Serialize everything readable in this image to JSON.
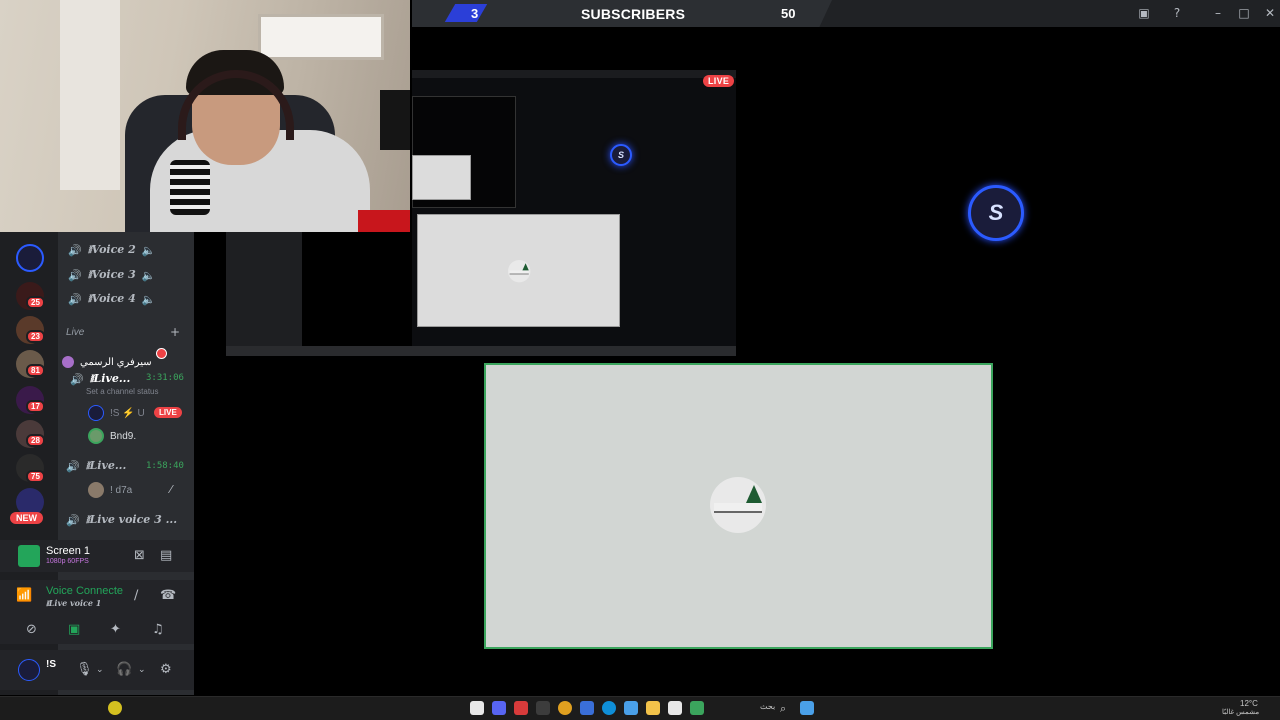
{
  "topbar": {
    "left_count": "3",
    "title": "SUBSCRIBERS",
    "right_count": "50"
  },
  "preview": {
    "live_label": "LIVE",
    "logo_text": "S"
  },
  "servers": {
    "badges": [
      "25",
      "23",
      "81",
      "17",
      "28",
      "75"
    ],
    "new_label": "NEW"
  },
  "channels": {
    "voice_channels": [
      "⧚Voice 2",
      "⧚Voice 3",
      "⧚Voice 4"
    ],
    "category": "Live",
    "popup_user": "سيرفري الرسمي",
    "live1_name": "⧚Live...",
    "live1_timer": "3:31:06",
    "set_status": "Set a channel status",
    "streamer_name": "!S ⚡ U",
    "live_badge": "LIVE",
    "member_name": "Bnd9.",
    "live2_name": "⧚Live...",
    "live2_timer": "1:58:40",
    "member2_name": "! d7a",
    "live3_name": "⧚Live voice 3 ..."
  },
  "screen_panel": {
    "title": "Screen 1",
    "quality": "1080p 60FPS"
  },
  "voice_panel": {
    "status": "Voice Connecte",
    "channel": "⧚Live voice 1 "
  },
  "user_panel": {
    "name": "!S"
  },
  "taskbar": {
    "search_label": "بحث",
    "weather": "12°C",
    "weather_desc": "مشمس غالبًا"
  },
  "colors": {
    "accent_blue": "#2b5bff",
    "live_red": "#ed4245",
    "speaking_green": "#3ba55d",
    "sidebar_bg": "#2b2d31"
  }
}
